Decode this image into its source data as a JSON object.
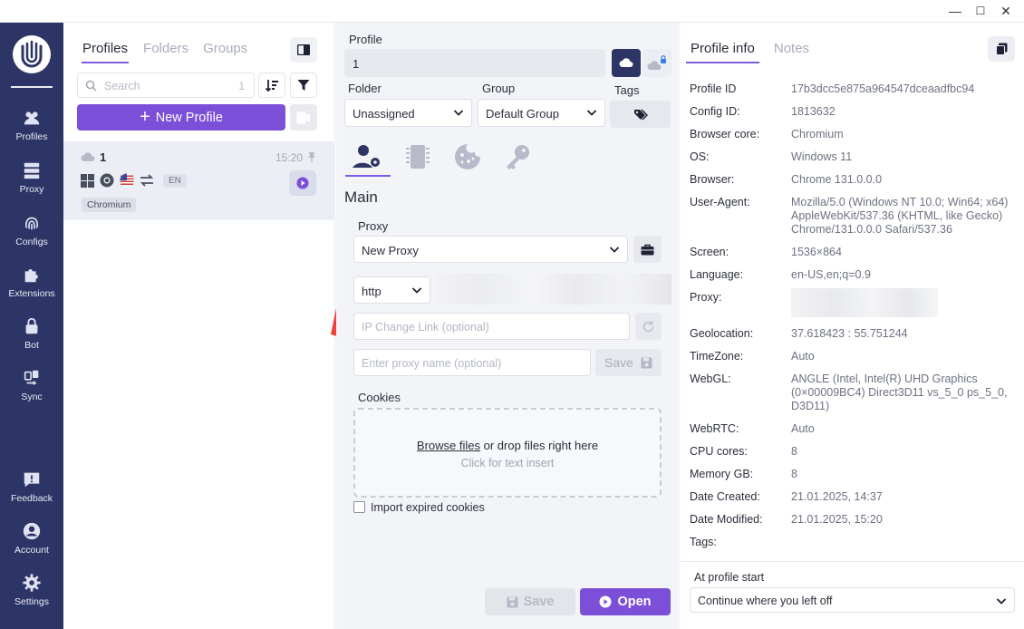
{
  "window": {
    "minimize": "—",
    "maximize": "☐",
    "close": "✕"
  },
  "sidebar": {
    "items": [
      {
        "label": "Profiles",
        "icon": "users-icon"
      },
      {
        "label": "Proxy",
        "icon": "server-icon"
      },
      {
        "label": "Configs",
        "icon": "fingerprint-icon"
      },
      {
        "label": "Extensions",
        "icon": "puzzle-icon"
      },
      {
        "label": "Bot",
        "icon": "lock-icon"
      },
      {
        "label": "Sync",
        "icon": "sync-icon"
      },
      {
        "label": "Feedback",
        "icon": "feedback-icon"
      },
      {
        "label": "Account",
        "icon": "account-icon"
      },
      {
        "label": "Settings",
        "icon": "gear-icon"
      }
    ]
  },
  "profiles_panel": {
    "tabs": [
      "Profiles",
      "Folders",
      "Groups"
    ],
    "search_placeholder": "Search",
    "search_count": "1",
    "new_profile_label": "New Profile",
    "profile": {
      "name": "1",
      "time": "15:20",
      "lang": "EN",
      "badge": "Chromium"
    }
  },
  "edit_panel": {
    "profile_label": "Profile",
    "profile_value": "1",
    "folder_label": "Folder",
    "folder_value": "Unassigned",
    "group_label": "Group",
    "group_value": "Default Group",
    "tags_label": "Tags",
    "section_title": "Main",
    "proxy_label": "Proxy",
    "proxy_value": "New Proxy",
    "protocol_value": "http",
    "ip_change_placeholder": "IP Change Link (optional)",
    "proxy_name_placeholder": "Enter proxy name (optional)",
    "save_small_label": "Save",
    "cookies_label": "Cookies",
    "browse_files": "Browse files",
    "drop_text": "or drop files right here",
    "click_text": "Click for text insert",
    "import_expired": "Import expired cookies",
    "save_label": "Save",
    "open_label": "Open"
  },
  "info_panel": {
    "tabs": [
      "Profile info",
      "Notes"
    ],
    "rows": {
      "profile_id": {
        "label": "Profile ID",
        "value": "17b3dcc5e875a964547dceaadfbc94"
      },
      "config_id": {
        "label": "Config ID:",
        "value": "1813632"
      },
      "browser_core": {
        "label": "Browser core:",
        "value": "Chromium"
      },
      "os": {
        "label": "OS:",
        "value": "Windows 11"
      },
      "browser": {
        "label": "Browser:",
        "value": "Chrome 131.0.0.0"
      },
      "user_agent": {
        "label": "User-Agent:",
        "value": "Mozilla/5.0 (Windows NT 10.0; Win64; x64) AppleWebKit/537.36 (KHTML, like Gecko) Chrome/131.0.0.0 Safari/537.36"
      },
      "screen": {
        "label": "Screen:",
        "value": "1536×864"
      },
      "language": {
        "label": "Language:",
        "value": "en-US,en;q=0.9"
      },
      "proxy": {
        "label": "Proxy:",
        "value": ""
      },
      "geolocation": {
        "label": "Geolocation:",
        "value": "37.618423 : 55.751244"
      },
      "timezone": {
        "label": "TimeZone:",
        "value": "Auto"
      },
      "webgl": {
        "label": "WebGL:",
        "value": "ANGLE (Intel, Intel(R) UHD Graphics (0×00009BC4) Direct3D11 vs_5_0 ps_5_0, D3D11)"
      },
      "webrtc": {
        "label": "WebRTC:",
        "value": "Auto"
      },
      "cpu": {
        "label": "CPU cores:",
        "value": "8"
      },
      "memory": {
        "label": "Memory GB:",
        "value": "8"
      },
      "created": {
        "label": "Date Created:",
        "value": "21.01.2025, 14:37"
      },
      "modified": {
        "label": "Date Modified:",
        "value": "21.01.2025, 15:20"
      },
      "tags": {
        "label": "Tags:",
        "value": ""
      }
    },
    "start_label": "At profile start",
    "start_value": "Continue where you left off"
  },
  "colors": {
    "accent": "#7c4fd8",
    "sidebar": "#2d3566",
    "arrow": "#f0413a"
  }
}
